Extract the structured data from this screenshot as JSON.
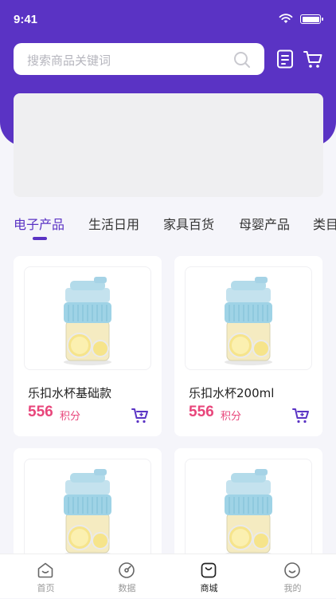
{
  "status_bar": {
    "time": "9:41"
  },
  "search": {
    "placeholder": "搜索商品关键词"
  },
  "categories": [
    {
      "label": "电子产品",
      "active": true
    },
    {
      "label": "生活日用",
      "active": false
    },
    {
      "label": "家具百货",
      "active": false
    },
    {
      "label": "母婴产品",
      "active": false
    },
    {
      "label": "类目",
      "active": false
    }
  ],
  "products": [
    {
      "name": "乐扣水杯基础款",
      "price": "556",
      "unit": "积分"
    },
    {
      "name": "乐扣水杯200ml",
      "price": "556",
      "unit": "积分"
    },
    {
      "name": "",
      "price": "",
      "unit": ""
    },
    {
      "name": "",
      "price": "",
      "unit": ""
    }
  ],
  "bottom_nav": [
    {
      "label": "首页",
      "icon": "home-icon"
    },
    {
      "label": "数据",
      "icon": "data-icon"
    },
    {
      "label": "商城",
      "icon": "mall-icon",
      "active": true
    },
    {
      "label": "我的",
      "icon": "profile-icon"
    }
  ],
  "colors": {
    "brand": "#5a33c4",
    "price": "#e8467b"
  }
}
